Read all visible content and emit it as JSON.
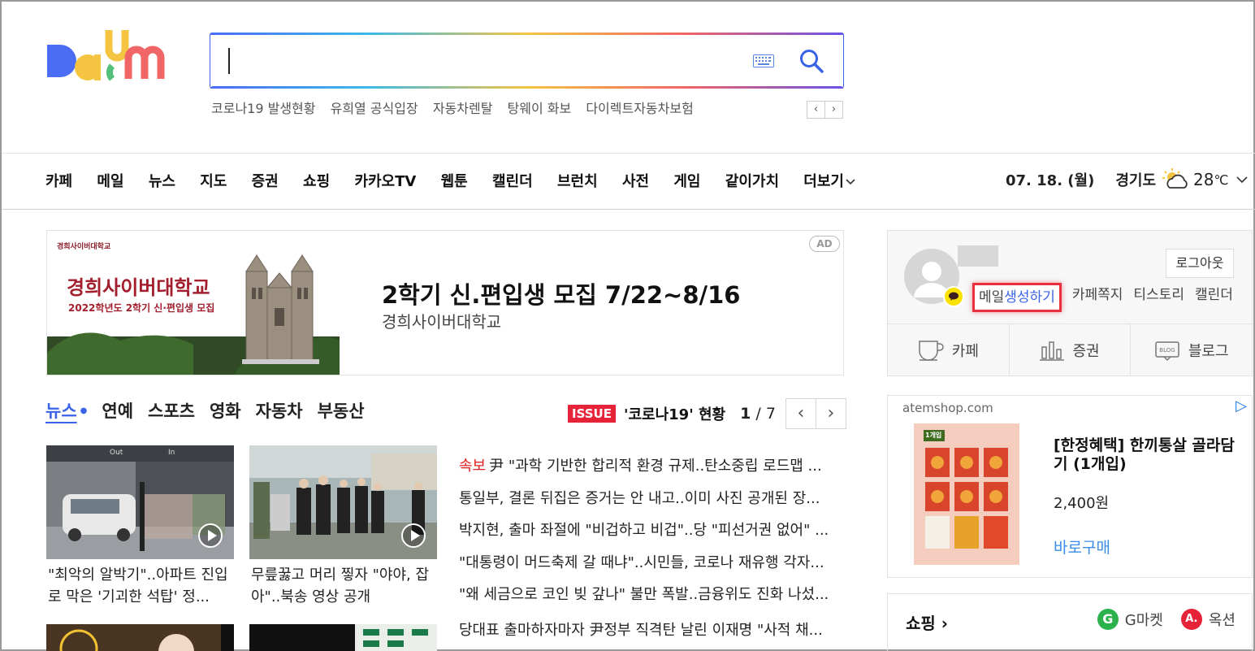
{
  "header": {
    "logo_text": "Daum",
    "search": {
      "value": "",
      "placeholder": ""
    },
    "trending": [
      "코로나19 발생현황",
      "유희열 공식입장",
      "자동차렌탈",
      "탕웨이 화보",
      "다이렉트자동차보험"
    ],
    "trend_prev": "‹",
    "trend_next": "›"
  },
  "gnb": {
    "items": [
      "카페",
      "메일",
      "뉴스",
      "지도",
      "증권",
      "쇼핑",
      "카카오TV",
      "웹툰",
      "캘린더",
      "브런치",
      "사전",
      "게임",
      "같이가치",
      "더보기"
    ],
    "date": "07. 18. (월)",
    "region": "경기도",
    "temperature": "28",
    "temp_unit": "℃"
  },
  "ad_banner": {
    "school_small": "경희사이버대학교",
    "school_big": "경희사이버대학교",
    "school_desc": "2022학년도 2학기 신·편입생 모집",
    "title": "2학기 신.편입생 모집 7/22~8/16",
    "subtitle": "경희사이버대학교",
    "badge": "AD"
  },
  "news": {
    "tabs": [
      "뉴스",
      "연예",
      "스포츠",
      "영화",
      "자동차",
      "부동산"
    ],
    "issue_badge": "ISSUE",
    "issue_title": "'코로나19' 현황",
    "issue_page_current": "1",
    "issue_page_total": "/ 7",
    "thumbs": [
      {
        "caption": "\"최악의 알박기\"..아파트 진입로 막은 '기괴한 석탑' 정...",
        "label_out": "Out",
        "label_in": "In"
      },
      {
        "caption": "무릎꿇고 머리 찧자 \"야야, 잡아\"..북송 영상 공개"
      }
    ],
    "headlines": [
      {
        "flash": "속보",
        "text": "尹 \"과학 기반한 합리적 환경 규제..탄소중립 로드맵 ..."
      },
      {
        "text": "통일부, 결론 뒤집은 증거는 안 내고..이미 사진 공개된 장..."
      },
      {
        "text": "박지현, 출마 좌절에 \"비겁하고 비겁\"..당 \"피선거권 없어\" ..."
      },
      {
        "text": "\"대통령이 머드축제 갈 때냐\"..시민들, 코로나 재유행 각자..."
      },
      {
        "text": "\"왜 세금으로 코인 빚 갚나\" 불만 폭발..금융위도 진화 나섰..."
      },
      {
        "text": "당대표 출마하자마자 尹정부 직격탄 날린 이재명 \"사적 채..."
      }
    ]
  },
  "login": {
    "logout_label": "로그아웃",
    "mail_prefix": "메일",
    "mail_action": "생성하기",
    "links": [
      "카페쪽지",
      "티스토리",
      "캘린더"
    ],
    "services": [
      "카페",
      "증권",
      "블로그"
    ],
    "blog_icon_text": "BLOG"
  },
  "ad2": {
    "domain": "atemshop.com",
    "title": "[한정혜택] 한끼통살 골라담기 (1개입)",
    "price": "2,400원",
    "buy": "바로구매",
    "product_tag": "1개입"
  },
  "shopping": {
    "title": "쇼핑 ›",
    "gmarket": "G마켓",
    "auction": "옥션",
    "g_letter": "G",
    "a_letter": "A."
  },
  "colors": {
    "brand_blue": "#3a64e8",
    "issue_red": "#e7233a",
    "highlight": "#e8303f",
    "kakao_yellow": "#fae100"
  }
}
